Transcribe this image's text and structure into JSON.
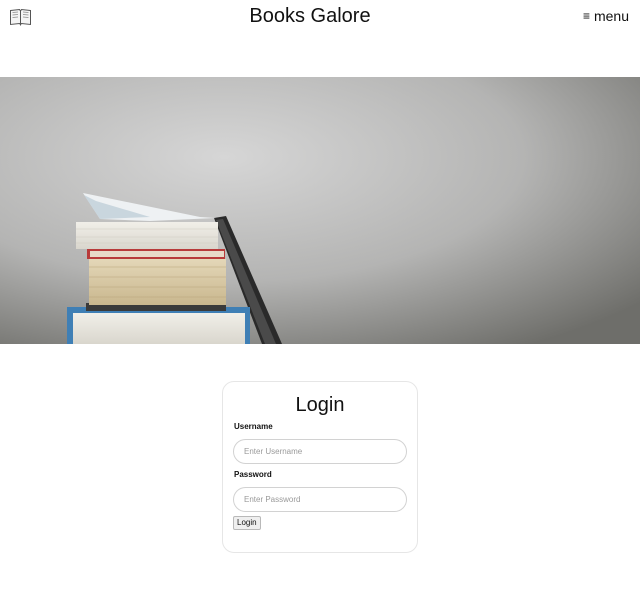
{
  "header": {
    "title": "Books Galore",
    "menu_label": "menu",
    "menu_icon": "hamburger-icon",
    "logo_icon": "open-book-icon"
  },
  "hero": {
    "image": "stack-of-books-photo"
  },
  "login": {
    "title": "Login",
    "username_label": "Username",
    "username_placeholder": "Enter Username",
    "username_value": "",
    "password_label": "Password",
    "password_placeholder": "Enter Password",
    "password_value": "",
    "button_label": "Login"
  },
  "colors": {
    "hero_light": "#cfcfcf",
    "hero_dark": "#6f6f6b",
    "card_border": "#e6e6e6"
  }
}
